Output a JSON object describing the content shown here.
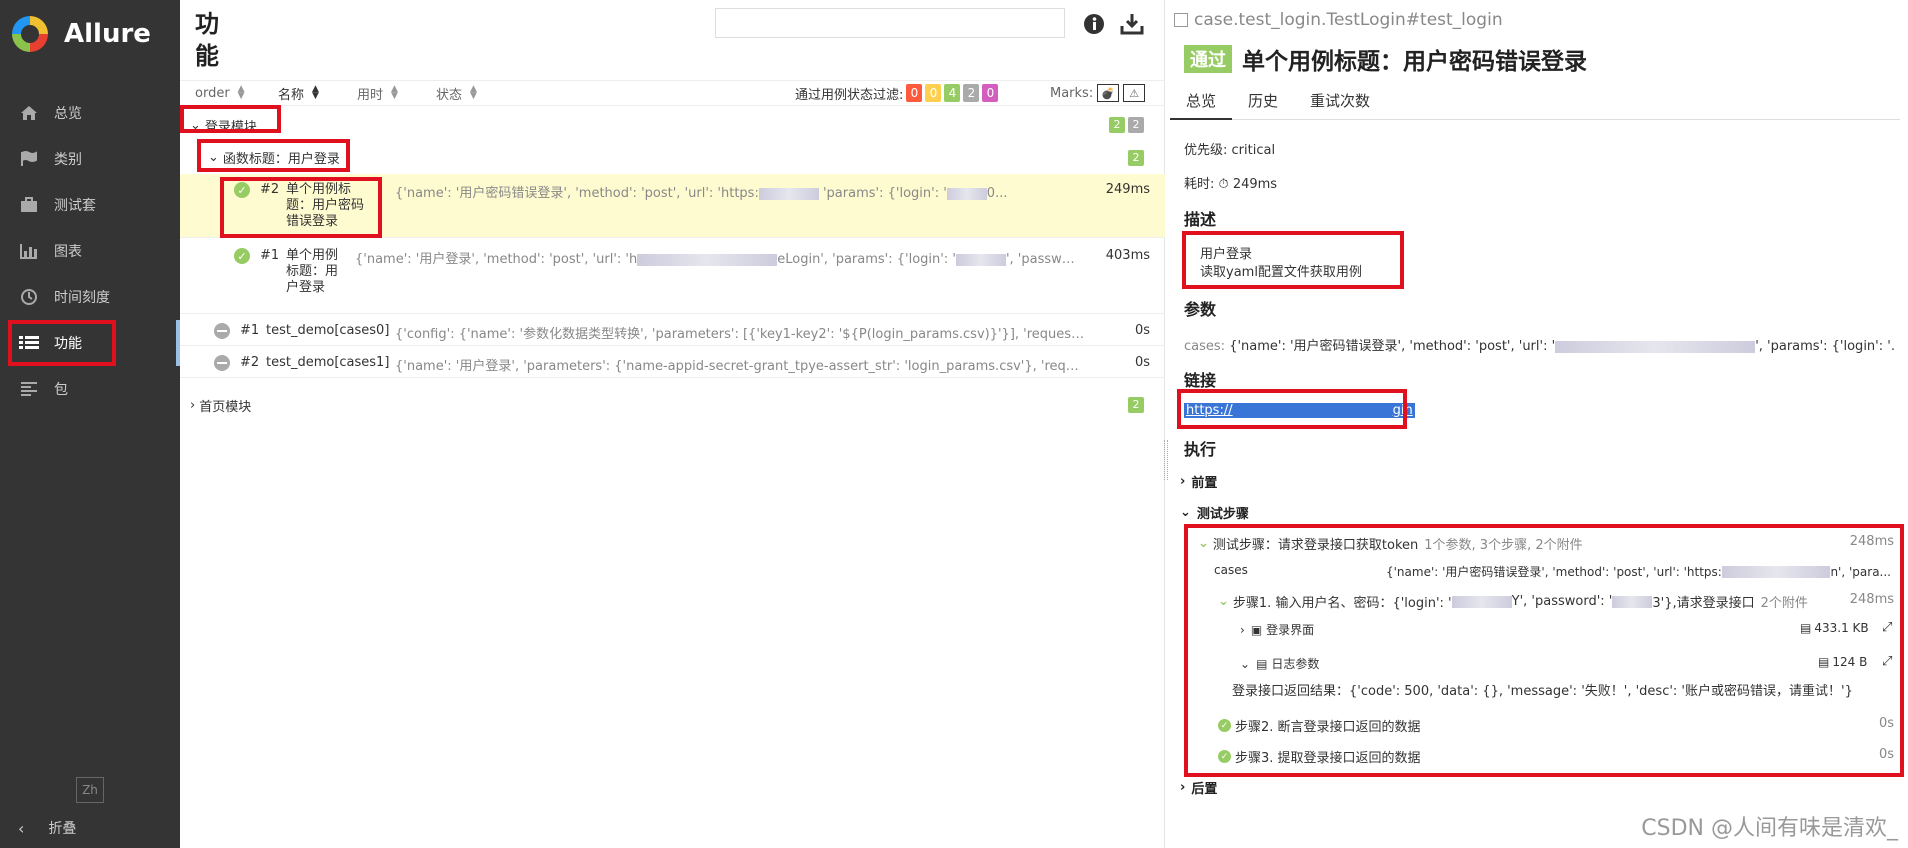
{
  "sidebar": {
    "brand": "Allure",
    "items": [
      {
        "label": "总览",
        "icon": "home-icon"
      },
      {
        "label": "类别",
        "icon": "flag-icon"
      },
      {
        "label": "测试套",
        "icon": "briefcase-icon"
      },
      {
        "label": "图表",
        "icon": "bar-chart-icon"
      },
      {
        "label": "时间刻度",
        "icon": "clock-icon"
      },
      {
        "label": "功能",
        "icon": "list-icon",
        "active": true
      },
      {
        "label": "包",
        "icon": "align-left-icon"
      }
    ],
    "lang": "Zh",
    "collapse_label": "折叠"
  },
  "middle": {
    "title": "功能",
    "search_placeholder": "",
    "sort_columns": [
      "order",
      "名称",
      "用时",
      "状态"
    ],
    "filter_label": "通过用例状态过滤:",
    "filter_counts": [
      "0",
      "0",
      "4",
      "2",
      "0"
    ],
    "marks_label": "Marks:",
    "groups": [
      {
        "name": "登录模块",
        "counts": [
          "2",
          "2"
        ]
      },
      {
        "name": "函数标题：用户登录",
        "counts": [
          "2"
        ]
      },
      {
        "name": "首页模块",
        "counts": [
          "2"
        ]
      }
    ],
    "tests": [
      {
        "num": "#2",
        "name": "单个用例标题：用户密码错误登录",
        "params": "{'name': '用户密码错误登录', 'method': 'post', 'url': 'https:",
        "params2": "'params': {'login': '",
        "params3": "0...",
        "duration": "249ms"
      },
      {
        "num": "#1",
        "name": "单个用例标题：用户登录",
        "params": "{'name': '用户登录', 'method': 'post', 'url': 'h",
        "params2": "eLogin', 'params': {'login': '",
        "params3": "', 'password...",
        "duration": "403ms"
      },
      {
        "num": "#1",
        "name": "test_demo[cases0]",
        "params": "{'config': {'name': '参数化数据类型转换', 'parameters': [{'key1-key2': '${P(login_params.csv)}'}], 'request': {'base_url': '...",
        "duration": "0s"
      },
      {
        "num": "#2",
        "name": "test_demo[cases1]",
        "params": "{'name': '用户登录', 'parameters': {'name-appid-secret-grant_tpye-assert_str': 'login_params.csv'}, 'request': {'method'...",
        "duration": "0s"
      }
    ]
  },
  "detail": {
    "path": "case.test_login.TestLogin#test_login",
    "status": "通过",
    "title": "单个用例标题：用户密码错误登录",
    "tabs": [
      "总览",
      "历史",
      "重试次数"
    ],
    "priority": "优先级: critical",
    "duration_label": "耗时:",
    "duration": "249ms",
    "desc_heading": "描述",
    "desc_lines": [
      "用户登录",
      "读取yaml配置文件获取用例"
    ],
    "params_heading": "参数",
    "param_key": "cases:",
    "param_value": "{'name': '用户密码错误登录', 'method': 'post', 'url': '",
    "param_value2": "', 'params': {'login': '...",
    "links_heading": "链接",
    "link_text_a": "https://",
    "link_text_b": "gin",
    "exec_heading": "执行",
    "setup": "前置",
    "test_steps": "测试步骤",
    "teardown": "后置",
    "steps": {
      "main": "测试步骤：请求登录接口获取token",
      "main_meta": "1个参数, 3个步骤, 2个附件",
      "main_dur": "248ms",
      "cases_key": "cases",
      "cases_val": "{'name': '用户密码错误登录', 'method': 'post', 'url': 'https:",
      "cases_val2": "n', 'para...",
      "step1": "步骤1. 输入用户名、密码：{'login': '",
      "step1b": "Y', 'password': '",
      "step1c": "3'},请求登录接口",
      "step1_meta": "2个附件",
      "step1_dur": "248ms",
      "attach1": "登录界面",
      "attach1_size": "433.1 KB",
      "attach2": "日志参数",
      "attach2_size": "124 B",
      "log_result": "登录接口返回结果：{'code': 500, 'data': {}, 'message': '失败！', 'desc': '账户或密码错误，请重试！'}",
      "step2": "步骤2. 断言登录接口返回的数据",
      "step2_dur": "0s",
      "step3": "步骤3. 提取登录接口返回的数据",
      "step3_dur": "0s"
    },
    "watermark": "CSDN @人间有味是清欢_"
  }
}
